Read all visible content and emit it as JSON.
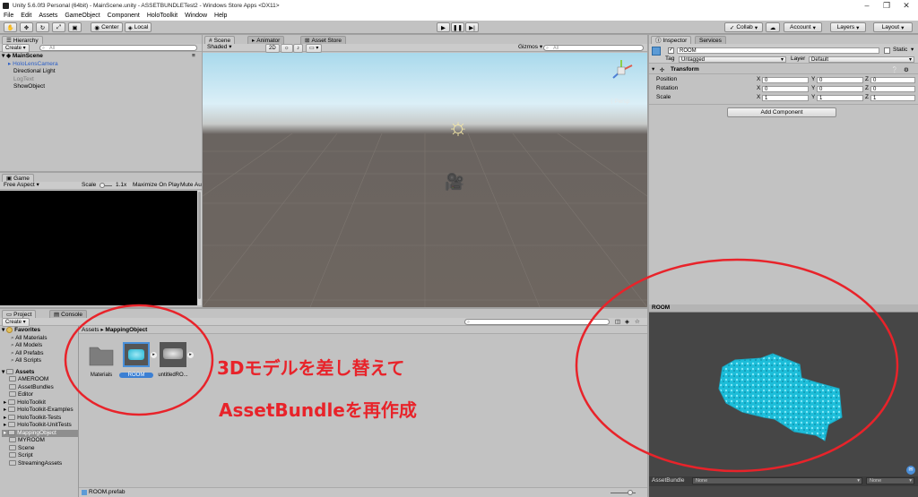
{
  "window": {
    "title": "Unity 5.6.0f3 Personal (64bit) - MainScene.unity - ASSETBUNDLETest2 - Windows Store Apps <DX11>"
  },
  "menu": [
    "File",
    "Edit",
    "Assets",
    "GameObject",
    "Component",
    "HoloToolkit",
    "Window",
    "Help"
  ],
  "toolbar": {
    "pivot": "Center",
    "space": "Local",
    "collab": "Collab",
    "account": "Account",
    "layers": "Layers",
    "layout": "Layout"
  },
  "hierarchy": {
    "tab": "Hierarchy",
    "create": "Create",
    "search": "All",
    "scene": "MainScene",
    "items": [
      "HoloLensCamera",
      "Directional Light",
      "LogText",
      "ShowObject"
    ]
  },
  "scene": {
    "tabs": [
      "Scene",
      "Animator",
      "Asset Store"
    ],
    "shading": "Shaded",
    "mode2d": "2D",
    "gizmos": "Gizmos",
    "search": "All",
    "persp": "Persp"
  },
  "game": {
    "tab": "Game",
    "aspect": "Free Aspect",
    "scale_label": "Scale",
    "scale_value": "1.1x",
    "maximize": "Maximize On Play",
    "mute": "Mute Au"
  },
  "inspector": {
    "tabs": [
      "Inspector",
      "Services"
    ],
    "object_name": "ROOM",
    "static": "Static",
    "tag_label": "Tag",
    "tag_value": "Untagged",
    "layer_label": "Layer",
    "layer_value": "Default",
    "transform": "Transform",
    "rows": [
      {
        "label": "Position",
        "x": "0",
        "y": "0",
        "z": "0"
      },
      {
        "label": "Rotation",
        "x": "0",
        "y": "0",
        "z": "0"
      },
      {
        "label": "Scale",
        "x": "1",
        "y": "1",
        "z": "1"
      }
    ],
    "add_component": "Add Component"
  },
  "project": {
    "tabs": [
      "Project",
      "Console"
    ],
    "create": "Create",
    "favorites": {
      "title": "Favorites",
      "items": [
        "All Materials",
        "All Models",
        "All Prefabs",
        "All Scripts"
      ]
    },
    "assets": {
      "title": "Assets",
      "items": [
        "AMEROOM",
        "AssetBundles",
        "Editor",
        "HoloToolkit",
        "HoloToolkit-Examples",
        "HoloToolkit-Tests",
        "HoloToolkit-UnitTests",
        "MappingObject",
        "MYROOM",
        "Scene",
        "Script",
        "StreamingAssets"
      ]
    },
    "breadcrumb": [
      "Assets",
      "MappingObject"
    ],
    "grid_items": [
      "Materials",
      "ROOM",
      "untitledRO..."
    ],
    "selected_path": "ROOM.prefab"
  },
  "preview": {
    "title": "ROOM",
    "assetbundle_label": "AssetBundle",
    "bundle_value": "None",
    "variant_value": "None"
  },
  "annotation": {
    "line1": "3Dモデルを差し替えて",
    "line2": "AssetBundleを再作成",
    "color": "#e8232a"
  }
}
